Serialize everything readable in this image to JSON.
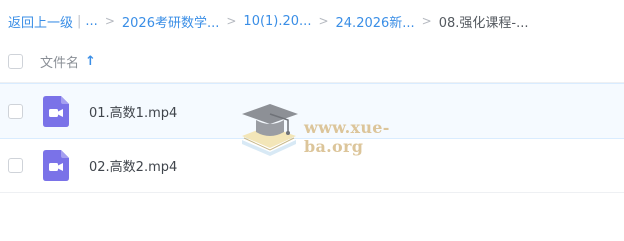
{
  "breadcrumb": {
    "back_label": "返回上一级",
    "ellipsis": "...",
    "items": [
      "2026考研数学...",
      "10(1).20...",
      "24.2026新..."
    ],
    "current": "08.强化课程-..."
  },
  "file_list": {
    "column_header": "文件名",
    "sort_direction": "ascending",
    "files": [
      {
        "name": "01.高数1.mp4",
        "type": "video",
        "icon": "video-file-icon"
      },
      {
        "name": "02.高数2.mp4",
        "type": "video",
        "icon": "video-file-icon"
      }
    ]
  },
  "watermark": {
    "text": "www.xue-ba.org"
  },
  "colors": {
    "accent": "#3a8ee6",
    "video_icon": "#7a72e8",
    "row_hover": "#f5faff"
  }
}
